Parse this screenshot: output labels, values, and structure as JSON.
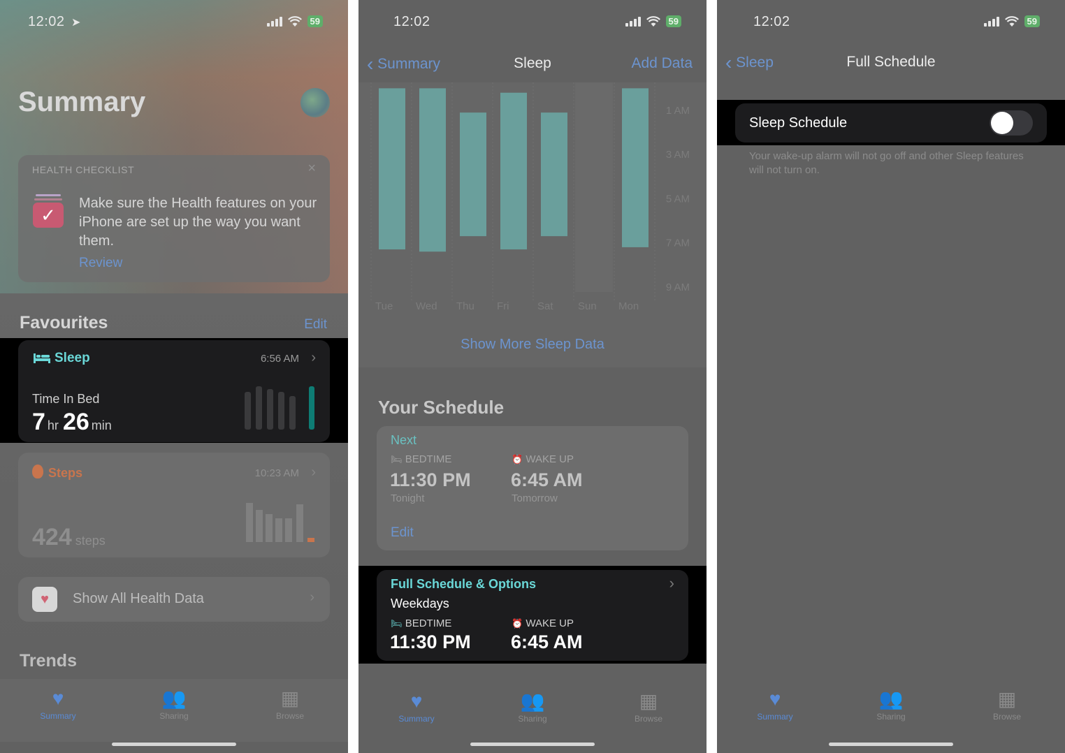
{
  "p1": {
    "time": "12:02",
    "battery": "59",
    "title": "Summary",
    "checklist": {
      "header": "HEALTH CHECKLIST",
      "text": "Make sure the Health features on your iPhone are set up the way you want them.",
      "link": "Review"
    },
    "favourites": {
      "title": "Favourites",
      "edit": "Edit"
    },
    "sleep": {
      "label": "Sleep",
      "time": "6:56 AM",
      "metric": "Time In Bed",
      "hours": "7",
      "hr_unit": "hr",
      "minutes": "26",
      "min_unit": "min"
    },
    "steps": {
      "label": "Steps",
      "time": "10:23 AM",
      "value": "424",
      "unit": "steps"
    },
    "show_all": "Show All Health Data",
    "trends": "Trends",
    "tabs": [
      "Summary",
      "Sharing",
      "Browse"
    ]
  },
  "p2": {
    "time": "12:02",
    "battery": "59",
    "back": "Summary",
    "title": "Sleep",
    "action": "Add Data",
    "chart_data": {
      "type": "bar",
      "categories": [
        "Tue",
        "Wed",
        "Thu",
        "Fri",
        "Sat",
        "Sun",
        "Mon"
      ],
      "y_ticks": [
        "1 AM",
        "3 AM",
        "5 AM",
        "7 AM",
        "9 AM"
      ],
      "series": [
        {
          "start": [
            0.0,
            0.0,
            1.1,
            0.2,
            1.1,
            null,
            0.0
          ],
          "end": [
            7.3,
            7.4,
            6.7,
            7.3,
            6.7,
            null,
            7.2
          ]
        }
      ]
    },
    "show_more": "Show More Sleep Data",
    "schedule_title": "Your Schedule",
    "next": {
      "label": "Next",
      "bed_label": "BEDTIME",
      "bed_time": "11:30 PM",
      "bed_sub": "Tonight",
      "wake_label": "WAKE UP",
      "wake_time": "6:45 AM",
      "wake_sub": "Tomorrow",
      "edit": "Edit"
    },
    "full": {
      "title": "Full Schedule & Options",
      "days": "Weekdays",
      "bed_label": "BEDTIME",
      "bed_time": "11:30 PM",
      "wake_label": "WAKE UP",
      "wake_time": "6:45 AM"
    },
    "tabs": [
      "Summary",
      "Sharing",
      "Browse"
    ]
  },
  "p3": {
    "time": "12:02",
    "battery": "59",
    "back": "Sleep",
    "title": "Full Schedule",
    "toggle_label": "Sleep Schedule",
    "toggle_on": false,
    "note": "Your wake-up alarm will not go off and other Sleep features will not turn on.",
    "tabs": [
      "Summary",
      "Sharing",
      "Browse"
    ]
  }
}
